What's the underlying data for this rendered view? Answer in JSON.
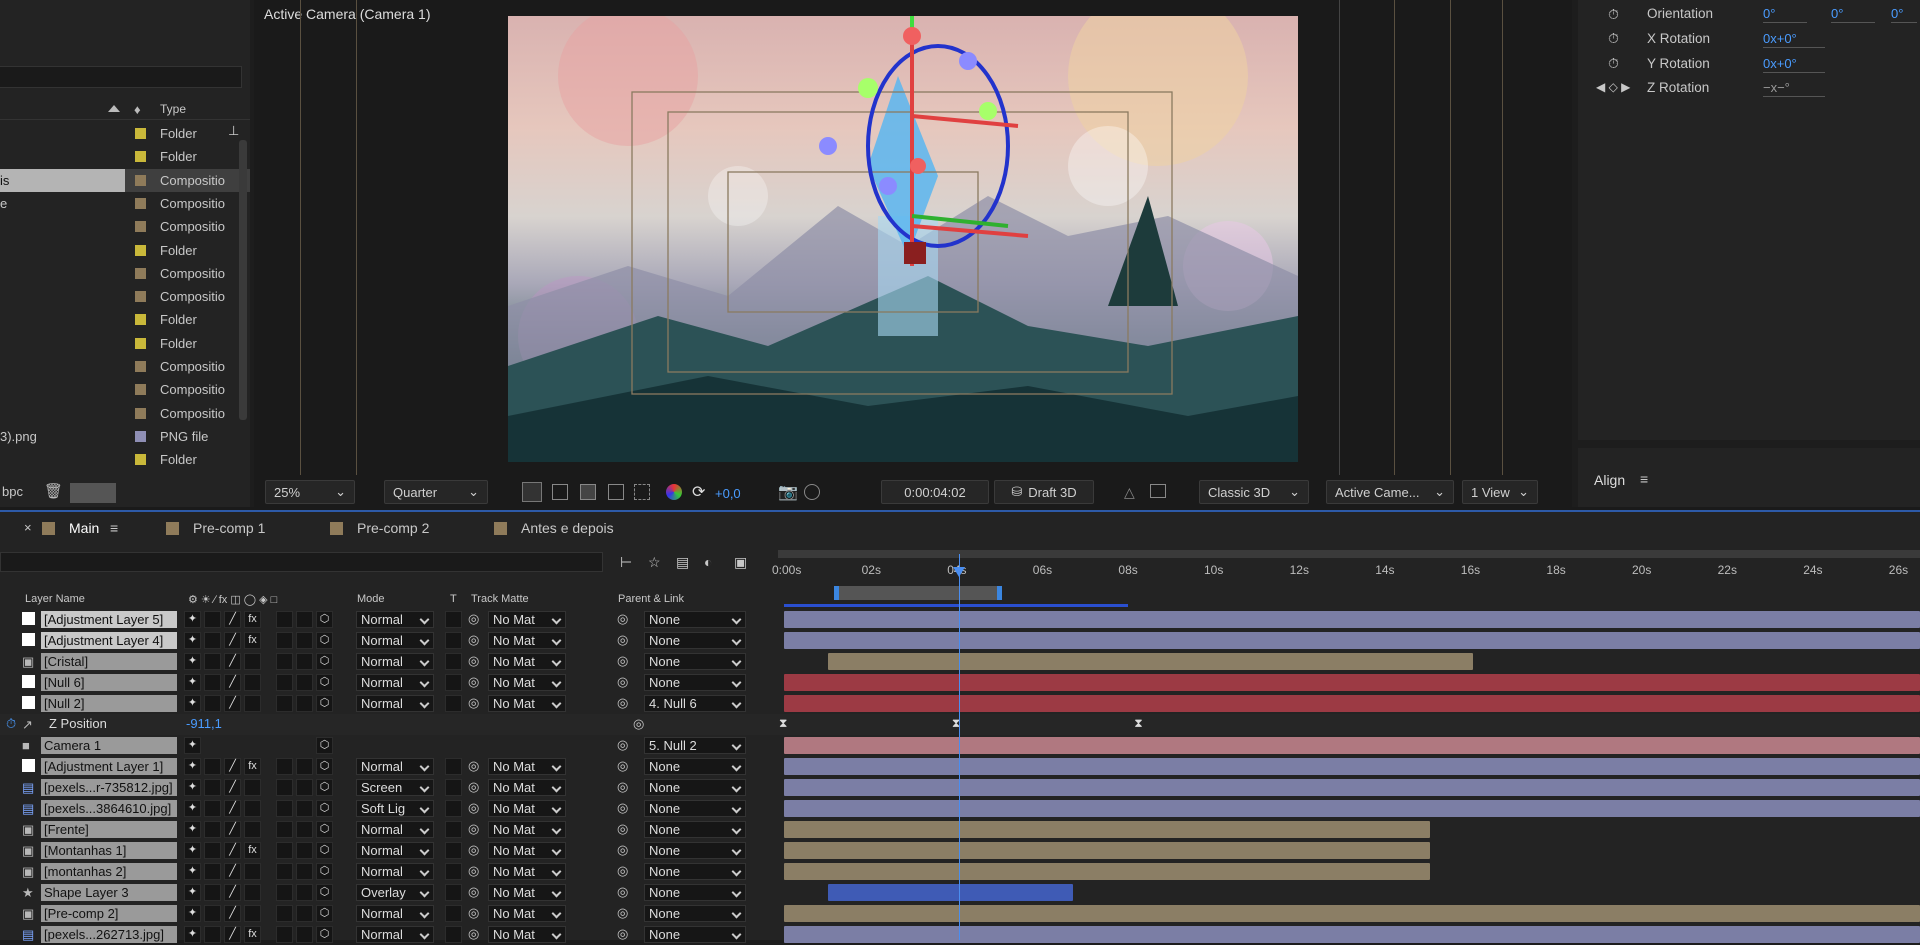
{
  "project": {
    "col_type": "Type",
    "items": [
      {
        "name": "",
        "type": "Folder",
        "color": "#c9b83a"
      },
      {
        "name": "",
        "type": "Folder",
        "color": "#c9b83a"
      },
      {
        "name": "is",
        "type": "Compositio",
        "color": "#8f7b5a"
      },
      {
        "name": "e",
        "type": "Compositio",
        "color": "#8f7b5a"
      },
      {
        "name": "",
        "type": "Compositio",
        "color": "#8f7b5a"
      },
      {
        "name": "",
        "type": "Folder",
        "color": "#c9b83a"
      },
      {
        "name": "",
        "type": "Compositio",
        "color": "#8f7b5a"
      },
      {
        "name": "",
        "type": "Compositio",
        "color": "#8f7b5a"
      },
      {
        "name": "",
        "type": "Folder",
        "color": "#c9b83a"
      },
      {
        "name": "",
        "type": "Folder",
        "color": "#c9b83a"
      },
      {
        "name": "",
        "type": "Compositio",
        "color": "#8f7b5a"
      },
      {
        "name": "",
        "type": "Compositio",
        "color": "#8f7b5a"
      },
      {
        "name": "",
        "type": "Compositio",
        "color": "#8f7b5a"
      },
      {
        "name": "3).png",
        "type": "PNG file",
        "color": "#8f8fb5"
      },
      {
        "name": "",
        "type": "Folder",
        "color": "#c9b83a"
      }
    ],
    "bpc": "bpc"
  },
  "viewer": {
    "label": "Active Camera (Camera 1)",
    "zoom": "25%",
    "resolution": "Quarter",
    "exposure": "+0,0",
    "timecode": "0:00:04:02",
    "draft3d": "Draft 3D",
    "renderer": "Classic 3D",
    "camera": "Active Came...",
    "views": "1 View"
  },
  "props": {
    "orientation": {
      "label": "Orientation",
      "v1": "0°",
      "v2": "0°",
      "v3": "0°"
    },
    "xrot": {
      "label": "X Rotation",
      "value": "0x+0°"
    },
    "yrot": {
      "label": "Y Rotation",
      "value": "0x+0°"
    },
    "zrot": {
      "label": "Z Rotation",
      "value": "−x−°"
    }
  },
  "align": {
    "title": "Align"
  },
  "timeline": {
    "tabs": [
      {
        "label": "Main",
        "color": "#8f7b5a"
      },
      {
        "label": "Pre-comp 1",
        "color": "#8f7b5a"
      },
      {
        "label": "Pre-comp 2",
        "color": "#8f7b5a"
      },
      {
        "label": "Antes e depois",
        "color": "#8f7b5a"
      }
    ],
    "headers": {
      "layer_name": "Layer Name",
      "mode": "Mode",
      "t": "T",
      "track_matte": "Track Matte",
      "parent": "Parent & Link"
    },
    "ruler": [
      "0:00s",
      "02s",
      "04s",
      "06s",
      "08s",
      "10s",
      "12s",
      "14s",
      "16s",
      "18s",
      "20s",
      "22s",
      "24s",
      "26s"
    ],
    "current_time_sec": 4.08,
    "timeline_max_sec": 26,
    "layers": [
      {
        "name": "[Adjustment Layer 5]",
        "icon": "solid-white",
        "mode": "Normal",
        "matte": "No Mat",
        "parent": "None",
        "fx": true,
        "start": 0,
        "end": 27,
        "color": "#7b7ea5"
      },
      {
        "name": "[Adjustment Layer 4]",
        "icon": "solid-white",
        "mode": "Normal",
        "matte": "No Mat",
        "parent": "None",
        "fx": true,
        "start": 0,
        "end": 27,
        "color": "#7b7ea5"
      },
      {
        "name": "[Cristal]",
        "icon": "comp-icon",
        "mode": "Normal",
        "matte": "No Mat",
        "parent": "None",
        "fx": false,
        "start": 1.03,
        "end": 16.1,
        "color": "#8b7e65"
      },
      {
        "name": "[Null 6]",
        "icon": "solid-white",
        "mode": "Normal",
        "matte": "No Mat",
        "parent": "None",
        "fx": false,
        "start": 0,
        "end": 27,
        "color": "#9c3a44"
      },
      {
        "name": "[Null 2]",
        "icon": "solid-white",
        "mode": "Normal",
        "matte": "No Mat",
        "parent": "4. Null 6",
        "fx": false,
        "start": 0,
        "end": 27,
        "color": "#9c3a44"
      },
      {
        "name": "Z Position",
        "icon": "graph-icon",
        "value": "-911,1",
        "parent_link": true,
        "property": true
      },
      {
        "name": "Camera 1",
        "icon": "camera-icon",
        "mode": "",
        "matte": "",
        "parent": "5. Null 2",
        "fx": false,
        "start": 0,
        "end": 27,
        "color": "#b07880"
      },
      {
        "name": "[Adjustment Layer 1]",
        "icon": "solid-white",
        "mode": "Normal",
        "matte": "No Mat",
        "parent": "None",
        "fx": true,
        "start": 0,
        "end": 27,
        "color": "#7b7ea5"
      },
      {
        "name": "[pexels...r-735812.jpg]",
        "icon": "image-icon",
        "mode": "Screen",
        "matte": "No Mat",
        "parent": "None",
        "fx": false,
        "start": 0,
        "end": 27,
        "color": "#7b7ea5"
      },
      {
        "name": "[pexels...3864610.jpg]",
        "icon": "image-icon",
        "mode": "Soft Lig",
        "matte": "No Mat",
        "parent": "None",
        "fx": false,
        "start": 0,
        "end": 27,
        "color": "#7b7ea5"
      },
      {
        "name": "[Frente]",
        "icon": "comp-icon",
        "mode": "Normal",
        "matte": "No Mat",
        "parent": "None",
        "fx": false,
        "start": 0,
        "end": 15.1,
        "color": "#8b7e65"
      },
      {
        "name": "[Montanhas 1]",
        "icon": "comp-icon",
        "mode": "Normal",
        "matte": "No Mat",
        "parent": "None",
        "fx": true,
        "start": 0,
        "end": 15.1,
        "color": "#8b7e65"
      },
      {
        "name": "[montanhas 2]",
        "icon": "comp-icon",
        "mode": "Normal",
        "matte": "No Mat",
        "parent": "None",
        "fx": false,
        "start": 0,
        "end": 15.1,
        "color": "#8b7e65"
      },
      {
        "name": "Shape Layer 3",
        "icon": "star-icon",
        "mode": "Overlay",
        "matte": "No Mat",
        "parent": "None",
        "fx": false,
        "start": 1.03,
        "end": 6.75,
        "color": "#3f5bb5"
      },
      {
        "name": "[Pre-comp 2]",
        "icon": "comp-icon",
        "mode": "Normal",
        "matte": "No Mat",
        "parent": "None",
        "fx": false,
        "start": 0,
        "end": 27,
        "color": "#8b7e65"
      },
      {
        "name": "[pexels...262713.jpg]",
        "icon": "image-icon",
        "mode": "Normal",
        "matte": "No Mat",
        "parent": "None",
        "fx": true,
        "start": 0,
        "end": 27,
        "color": "#7b7ea5"
      }
    ]
  }
}
